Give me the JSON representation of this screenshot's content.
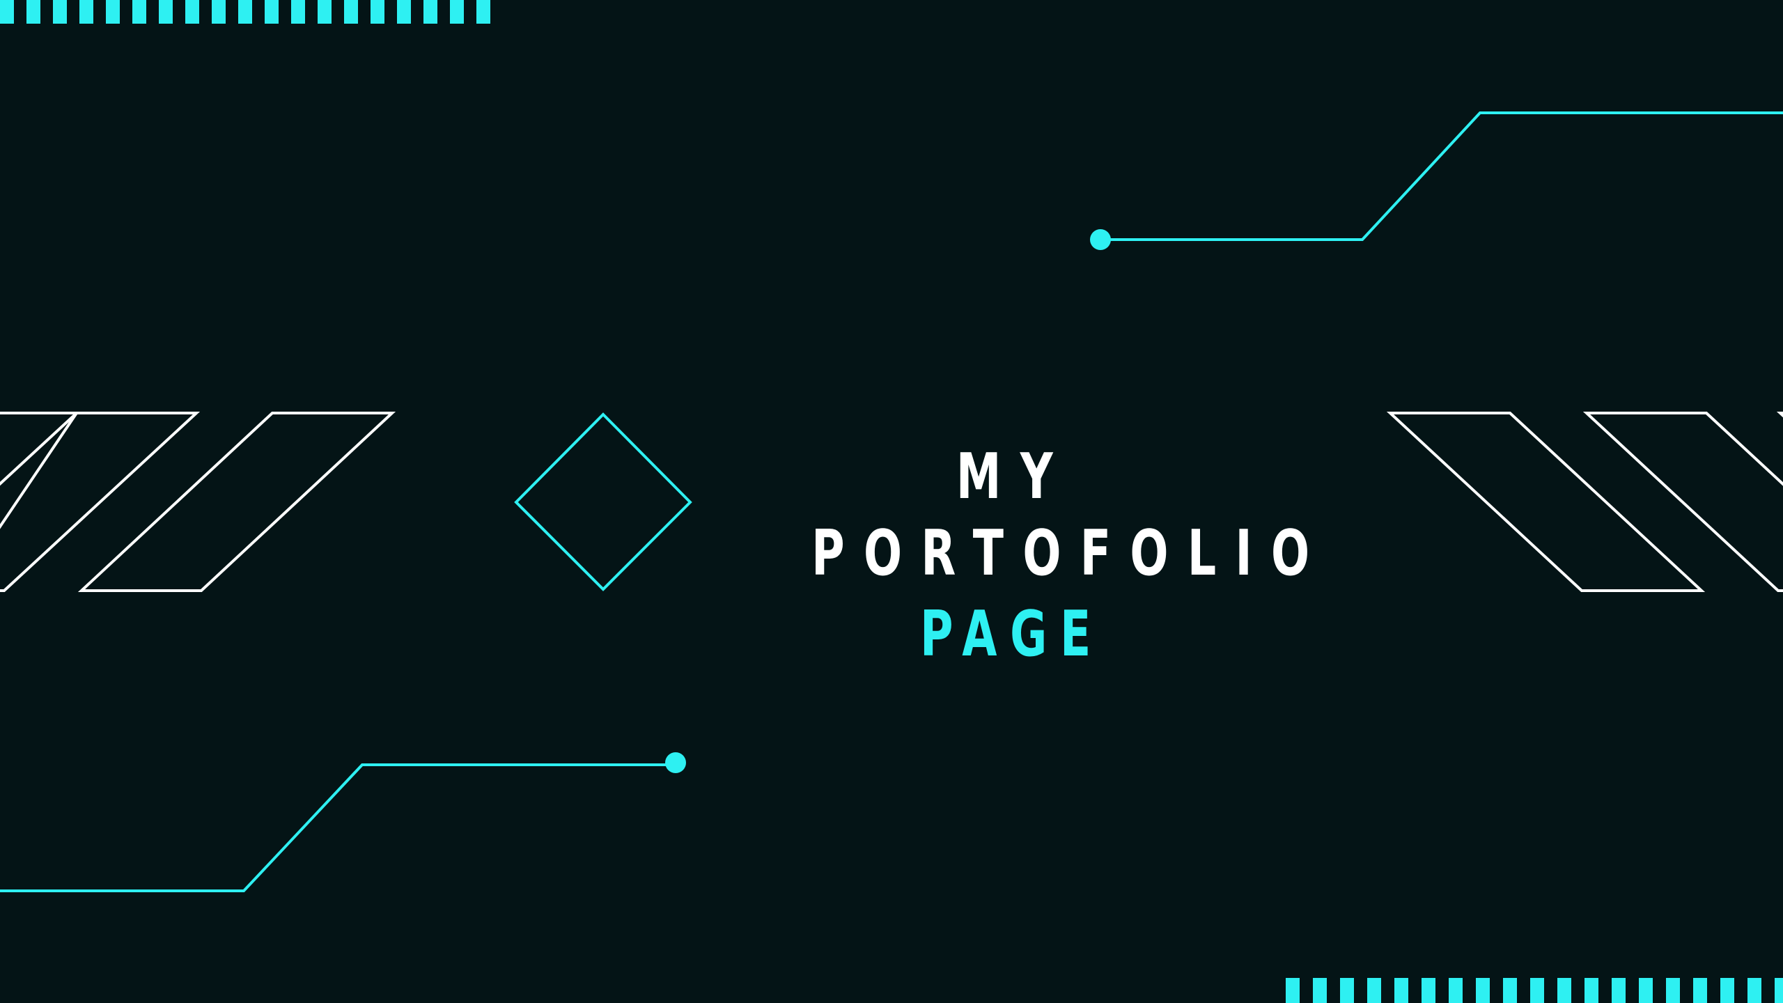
{
  "banner": {
    "title_line1": "MY PORTOFOLIO",
    "title_line2": "PAGE"
  },
  "colors": {
    "background": "#041416",
    "accent": "#2ef0f2",
    "outline": "#ffffff"
  }
}
